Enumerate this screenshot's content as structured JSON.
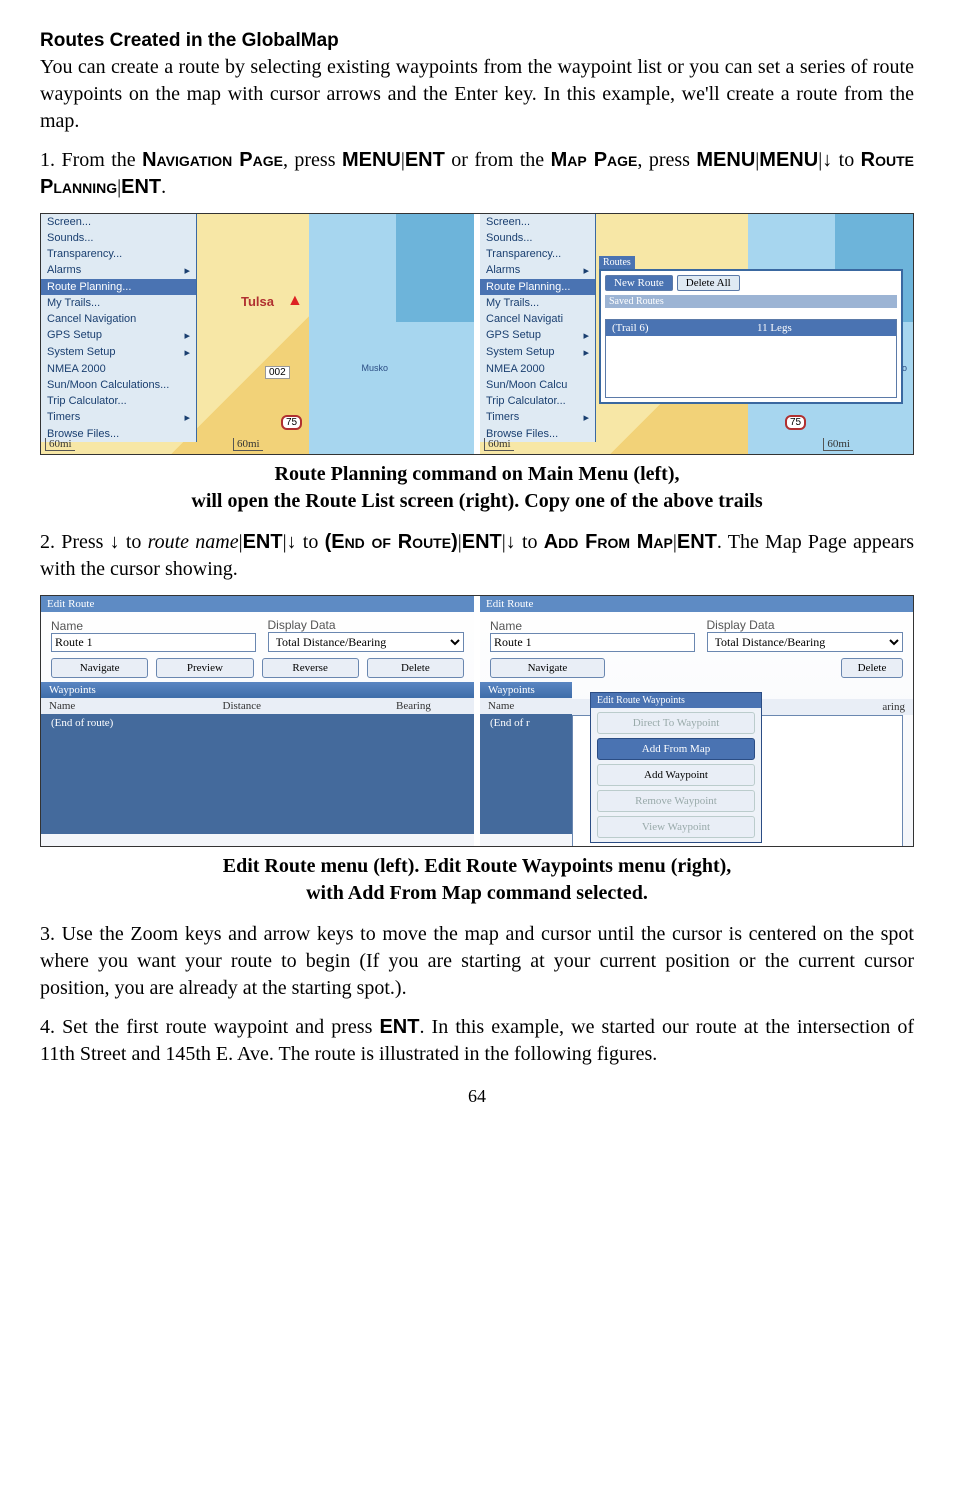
{
  "heading": "Routes Created in the GlobalMap",
  "intro_para": "You can create a route by selecting existing waypoints from the waypoint list or you can set a series of route waypoints on the map with cursor arrows and the Enter key. In this example, we'll create a route from the map.",
  "step1_prefix": "1. From the ",
  "step1_nav": "Navigation Page",
  "step1_mid1": ", press ",
  "step1_m1": "MENU",
  "step1_m2": "ENT",
  "step1_mid2": " or from the ",
  "step1_map": "Map Page",
  "step1_mid3": ", press ",
  "step1_m3": "MENU",
  "step1_m4": "MENU",
  "step1_to": " to ",
  "step1_route": "Route Planning",
  "step1_m5": "ENT",
  "step1_end": ".",
  "menu_items": [
    "Screen...",
    "Sounds...",
    "Transparency...",
    "Alarms",
    "Route Planning...",
    "My Trails...",
    "Cancel Navigation",
    "GPS Setup",
    "System Setup",
    "NMEA 2000",
    "Sun/Moon Calculations...",
    "Trip Calculator...",
    "Timers",
    "Browse Files..."
  ],
  "menu_sel_index": 4,
  "menu_arrow_idx": [
    3,
    7,
    8,
    12
  ],
  "menu2_items": [
    "Screen...",
    "Sounds...",
    "Transparency...",
    "Alarms",
    "Route Planning...",
    "My Trails...",
    "Cancel Navigati",
    "GPS Setup",
    "System Setup",
    "NMEA 2000",
    "Sun/Moon Calcu",
    "Trip Calculator...",
    "Timers",
    "Browse Files..."
  ],
  "map": {
    "city": "Tulsa",
    "scale": "60mi",
    "zoom": "002",
    "muskogee": "Musko",
    "hwy75": "75"
  },
  "routes_popup": {
    "title": "Routes",
    "new_btn": "New Route",
    "delete_btn": "Delete All",
    "saved_label": "Saved Routes",
    "row_name": "(Trail 6)",
    "row_legs": "11 Legs"
  },
  "caption1_a": "Route Planning command on Main Menu (left),",
  "caption1_b": "will open the Route List screen (right). Copy one of the above trails",
  "step2_prefix": "2. Press ↓ to ",
  "step2_routename": "route name",
  "step2_ent1": "ENT",
  "step2_mid1": "|↓ to ",
  "step2_end": "(End of Route)",
  "step2_ent2": "ENT",
  "step2_mid2": "|↓ to ",
  "step2_addfrom": "Add From Map",
  "step2_ent3": "ENT",
  "step2_tail": ". The Map Page appears with the cursor showing.",
  "edit": {
    "title": "Edit Route",
    "name_label": "Name",
    "display_label": "Display Data",
    "route_value": "Route 1",
    "display_value": "Total Distance/Bearing",
    "navigate": "Navigate",
    "preview": "Preview",
    "reverse": "Reverse",
    "delete": "Delete",
    "waypoints_hdr": "Waypoints",
    "col_name": "Name",
    "col_dist": "Distance",
    "col_bear": "Bearing",
    "end_row": "(End of route)",
    "end_row_short": "(End of r",
    "bearing_trim": "aring",
    "popup_title": "Edit Route Waypoints",
    "pm_direct": "Direct To Waypoint",
    "pm_addmap": "Add From Map",
    "pm_addwp": "Add Waypoint",
    "pm_remove": "Remove Waypoint",
    "pm_view": "View Waypoint"
  },
  "caption2_a": "Edit Route menu (left). Edit Route Waypoints menu (right),",
  "caption2_b": "with Add From Map command selected.",
  "step3": "3. Use the Zoom keys and arrow keys to move the map and cursor until the cursor is centered on the spot where you want your route to begin (If you are starting at your current position or the current cursor position, you are already at the starting spot.).",
  "step4_prefix": "4. Set the first route waypoint and press ",
  "step4_ent": "ENT",
  "step4_tail": ". In this example, we started our route at the intersection of 11th Street and 145th E. Ave. The route is illustrated in the following figures.",
  "page_number": "64"
}
